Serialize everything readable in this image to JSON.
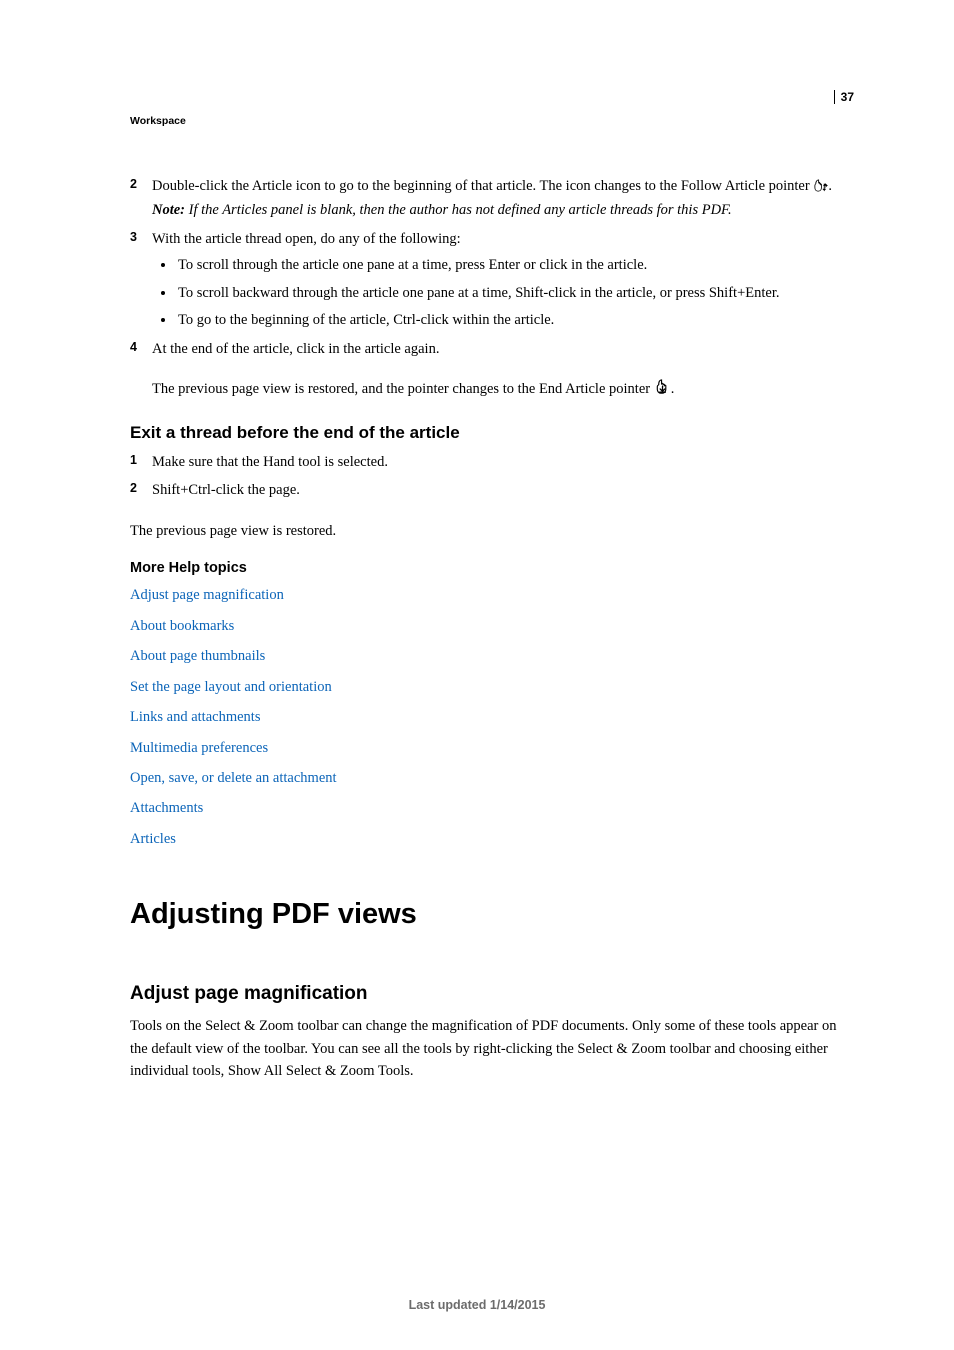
{
  "page_number": "37",
  "breadcrumb": "Workspace",
  "steps1": {
    "s2": {
      "num": "2",
      "text_a": "Double-click the Article icon to go to the beginning of that article. The icon changes to the Follow Article pointer ",
      "text_b": ".",
      "note_label": "Note:",
      "note_body": " If the Articles panel is blank, then the author has not defined any article threads for this PDF."
    },
    "s3": {
      "num": "3",
      "intro": "With the article thread open, do any of the following:",
      "b1": "To scroll through the article one pane at a time, press Enter or click in the article.",
      "b2": "To scroll backward through the article one pane at a time, Shift-click in the article, or press Shift+Enter.",
      "b3": "To go to the beginning of the article, Ctrl-click within the article."
    },
    "s4": {
      "num": "4",
      "text": "At the end of the article, click in the article again.",
      "follow_a": "The previous page view is restored, and the pointer changes to the End Article pointer ",
      "follow_b": "."
    }
  },
  "exit": {
    "heading": "Exit a thread before the end of the article",
    "s1": {
      "num": "1",
      "text": "Make sure that the Hand tool is selected."
    },
    "s2": {
      "num": "2",
      "text": "Shift+Ctrl-click the page."
    },
    "after": "The previous page view is restored."
  },
  "more_help": {
    "heading": "More Help topics",
    "links": {
      "l0": "Adjust page magnification",
      "l1": "About bookmarks",
      "l2": "About page thumbnails",
      "l3": "Set the page layout and orientation",
      "l4": "Links and attachments",
      "l5": "Multimedia preferences",
      "l6": "Open, save, or delete an attachment",
      "l7": "Attachments",
      "l8": "Articles"
    }
  },
  "chapter": "Adjusting PDF views",
  "topic": {
    "heading": "Adjust page magnification",
    "para": "Tools on the Select & Zoom toolbar can change the magnification of PDF documents. Only some of these tools appear on the default view of the toolbar. You can see all the tools by right-clicking the Select & Zoom toolbar and choosing either individual tools, Show All Select & Zoom Tools."
  },
  "footer": "Last updated 1/14/2015"
}
